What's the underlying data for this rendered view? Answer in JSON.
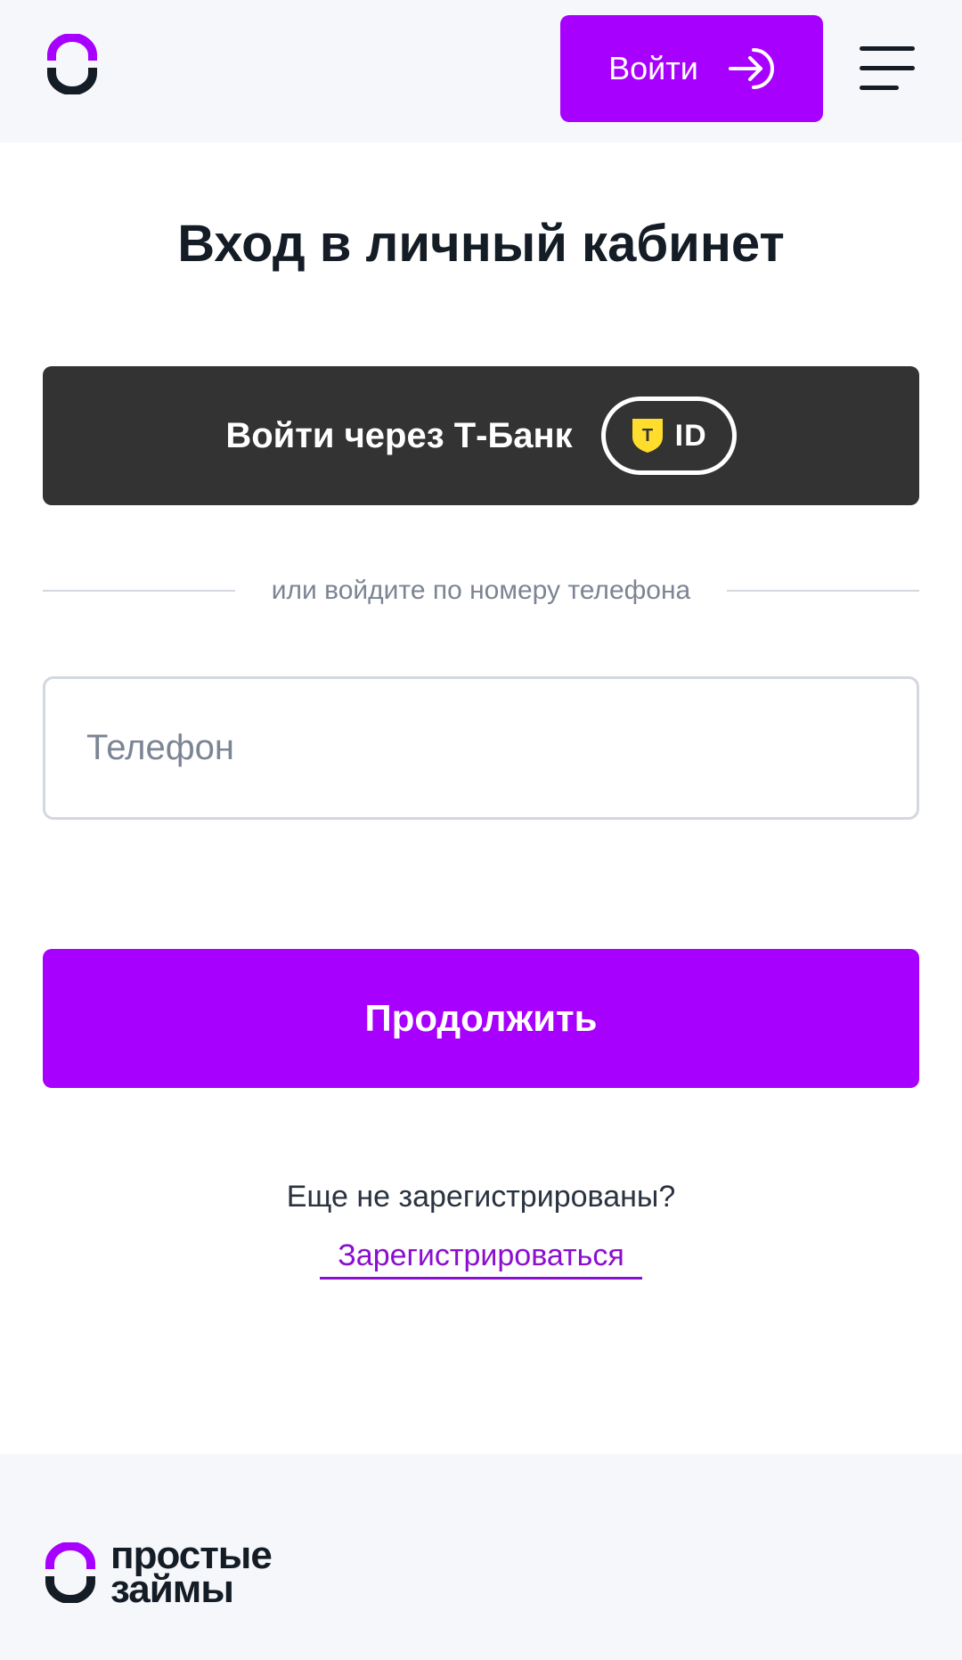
{
  "header": {
    "login_label": "Войти",
    "logo_icon": "brand-ring-icon",
    "menu_icon": "hamburger-menu-icon"
  },
  "main": {
    "title": "Вход в личный кабинет",
    "tbank_button": {
      "label": "Войти через Т-Банк",
      "badge_text": "ID",
      "badge_letter": "T"
    },
    "divider_text": "или войдите по номеру телефона",
    "phone_input": {
      "placeholder": "Телефон",
      "value": ""
    },
    "continue_label": "Продолжить",
    "not_registered_text": "Еще не зарегистрированы?",
    "register_link": "Зарегистрироваться"
  },
  "footer": {
    "brand_line1": "простые",
    "brand_line2": "займы"
  },
  "colors": {
    "accent": "#a800ff",
    "dark_button": "#333333",
    "link": "#8a0fcf",
    "header_bg": "#f6f7fb",
    "text": "#141c26",
    "muted": "#7c8594",
    "tbank_yellow": "#ffdd2d"
  }
}
